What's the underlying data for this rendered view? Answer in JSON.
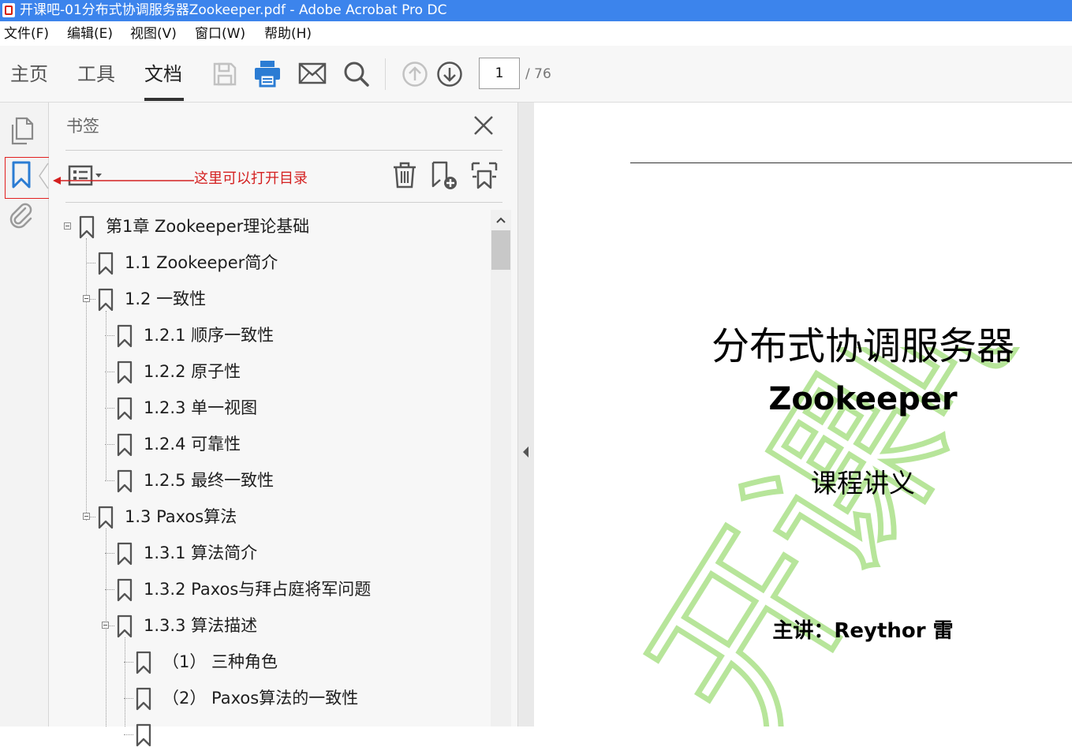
{
  "window": {
    "title": "开课吧-01分布式协调服务器Zookeeper.pdf - Adobe Acrobat Pro DC"
  },
  "menu": [
    "文件(F)",
    "编辑(E)",
    "视图(V)",
    "窗口(W)",
    "帮助(H)"
  ],
  "tabs": [
    {
      "label": "主页",
      "active": false
    },
    {
      "label": "工具",
      "active": false
    },
    {
      "label": "文档",
      "active": true
    }
  ],
  "toolbar": {
    "icons": [
      "save-icon",
      "print-icon",
      "email-icon",
      "search-icon",
      "prev-page-icon",
      "next-page-icon"
    ],
    "page_current": "1",
    "page_total": "/ 76",
    "accent": "#2b7cd3"
  },
  "rail": {
    "icons": [
      "pages-icon",
      "bookmarks-icon",
      "attachments-icon"
    ],
    "highlight_color": "#e21f1f"
  },
  "panel": {
    "title": "书签",
    "annotation": "这里可以打开目录",
    "tools": [
      "bookmark-options-icon",
      "delete-icon",
      "new-bookmark-icon",
      "bookmark-from-structure-icon"
    ]
  },
  "bookmarks": [
    {
      "label": "第1章 Zookeeper理论基础",
      "level": 0,
      "expander": true
    },
    {
      "label": "1.1 Zookeeper简介",
      "level": 1,
      "expander": false
    },
    {
      "label": "1.2 一致性",
      "level": 1,
      "expander": true
    },
    {
      "label": "1.2.1 顺序一致性",
      "level": 2,
      "expander": false
    },
    {
      "label": "1.2.2 原子性",
      "level": 2,
      "expander": false
    },
    {
      "label": "1.2.3 单一视图",
      "level": 2,
      "expander": false
    },
    {
      "label": "1.2.4 可靠性",
      "level": 2,
      "expander": false
    },
    {
      "label": "1.2.5 最终一致性",
      "level": 2,
      "expander": false
    },
    {
      "label": "1.3 Paxos算法",
      "level": 1,
      "expander": true
    },
    {
      "label": "1.3.1 算法简介",
      "level": 2,
      "expander": false
    },
    {
      "label": "1.3.2 Paxos与拜占庭将军问题",
      "level": 2,
      "expander": false
    },
    {
      "label": "1.3.3 算法描述",
      "level": 2,
      "expander": true
    },
    {
      "label": "（1） 三种角色",
      "level": 3,
      "expander": false
    },
    {
      "label": "（2） Paxos算法的一致性",
      "level": 3,
      "expander": false
    },
    {
      "label": "",
      "level": 3,
      "expander": false
    }
  ],
  "document": {
    "title_line1": "分布式协调服务器",
    "title_line2": "Zookeeper",
    "subtitle": "课程讲义",
    "lecturer": "主讲：Reythor 雷",
    "watermark": "开课吧",
    "watermark_color": "#b7e59a"
  }
}
